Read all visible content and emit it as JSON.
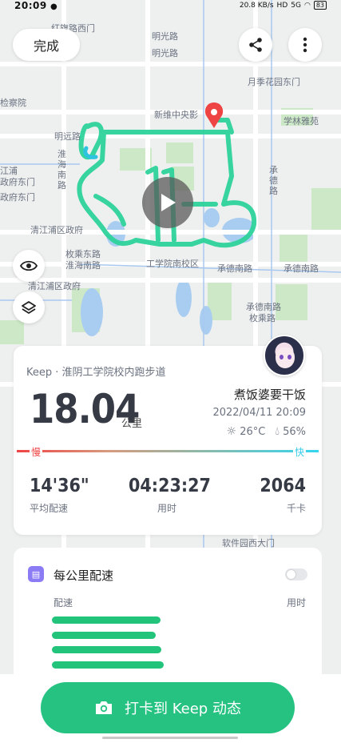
{
  "status_bar": {
    "time": "20:09",
    "network_speed": "20.8 KB/s",
    "hd": "HD",
    "signal": "5G",
    "battery": "83"
  },
  "header": {
    "done_label": "完成",
    "share_icon": "share-icon",
    "more_icon": "more-vertical-icon"
  },
  "map": {
    "labels": [
      "红旗路西门",
      "明光路",
      "明光路",
      "月季花园东门",
      "检察院",
      "新维中央影",
      "学林雅苑",
      "明远路",
      "淮海南路",
      "江浦",
      "政府东门",
      "政府东门",
      "承德路",
      "清江浦区政府",
      "枚乘东路",
      "淮海南路",
      "工学院南校区",
      "承德南路",
      "承德南路",
      "清江浦区政府",
      "承德南路",
      "枚乘路",
      "软件园西大门"
    ],
    "controls": {
      "eye_icon": "eye-icon",
      "layers_icon": "layers-icon",
      "play_icon": "play-icon"
    }
  },
  "summary": {
    "route_name": "Keep · 淮阴工学院校内跑步道",
    "distance": "18.04",
    "distance_unit": "公里",
    "username": "煮饭婆要干饭",
    "datetime": "2022/04/11 20:09",
    "temperature": "26°C",
    "humidity": "56%",
    "pace_slow_label": "慢",
    "pace_fast_label": "快",
    "stats": {
      "avg_pace": {
        "value": "14'36\"",
        "label": "平均配速"
      },
      "duration": {
        "value": "04:23:27",
        "label": "用时"
      },
      "calories": {
        "value": "2064",
        "label": "千卡"
      }
    }
  },
  "per_km": {
    "title": "每公里配速",
    "col_pace": "配速",
    "col_time": "用时",
    "toggle_on": false
  },
  "checkin": {
    "label": "打卡到 Keep 动态",
    "icon": "camera-icon"
  },
  "colors": {
    "accent": "#26c281",
    "route": "#2ed39b",
    "pace_slow": "#ef4444",
    "pace_fast": "#35d5f0"
  }
}
